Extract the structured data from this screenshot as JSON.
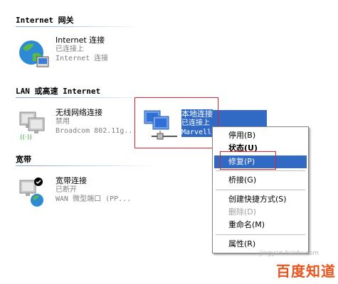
{
  "sections": {
    "internet": "Internet 网关",
    "lan": "LAN 或高速 Internet",
    "broadband": "宽带"
  },
  "connections": {
    "internet": {
      "name": "Internet 连接",
      "status": "已连接上",
      "device": "Internet 连接"
    },
    "wireless": {
      "name": "无线网络连接",
      "status": "禁用",
      "device": "Broadcom 802.11g..."
    },
    "local": {
      "name": "本地连接",
      "status": "已连接上",
      "device": "Marvell"
    },
    "broadband": {
      "name": "宽带连接",
      "status": "已断开",
      "device": "WAN 微型端口 (PP..."
    }
  },
  "context_menu": {
    "disable": "停用(B)",
    "status": "状态(U)",
    "repair": "修复(P)",
    "bridge": "桥接(G)",
    "shortcut": "创建快捷方式(S)",
    "delete": "删除(D)",
    "rename": "重命名(M)",
    "properties": "属性(R)"
  },
  "watermark": {
    "logo": "百度知道",
    "url": "jingyan.baidu.com"
  },
  "colors": {
    "selection": "#316ac5",
    "annotation_red": "#d9232e",
    "section_rule": "#7aa3d9",
    "watermark": "#e9541d"
  }
}
